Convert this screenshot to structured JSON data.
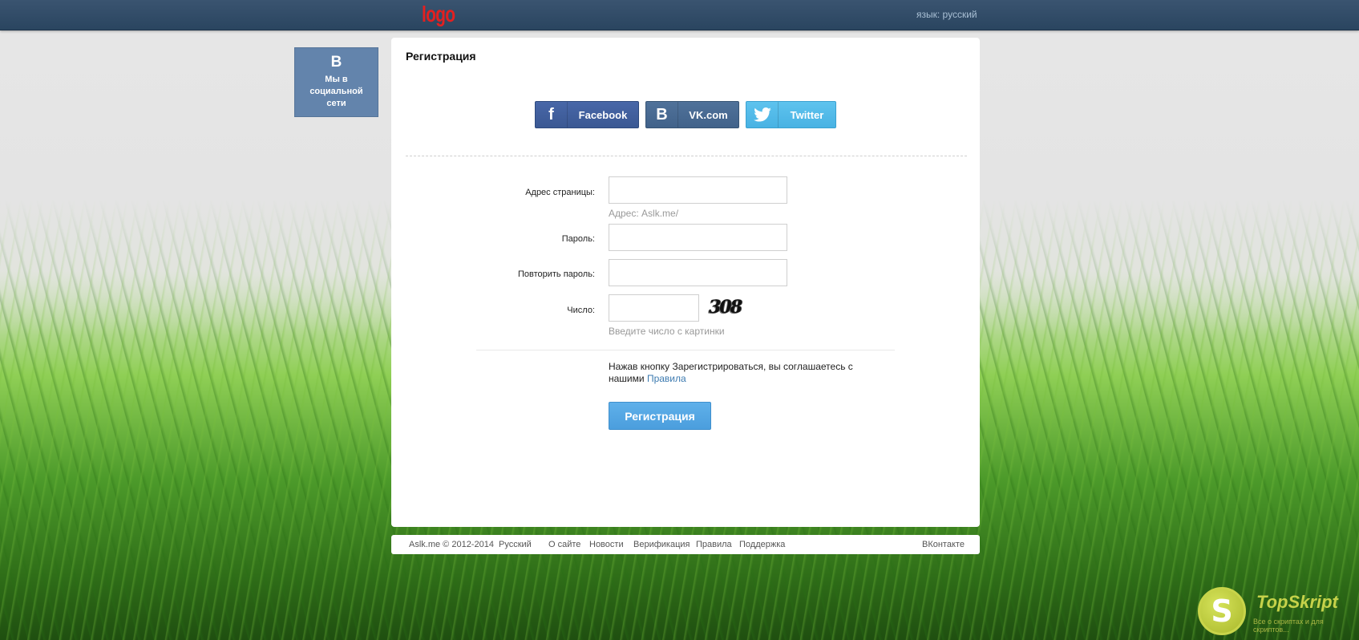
{
  "header": {
    "logo": "logo",
    "language_link": "язык: русский"
  },
  "social_sidebar": {
    "icon_letter": "B",
    "label": "Мы в социальной сети"
  },
  "registration": {
    "title": "Регистрация",
    "social_buttons": [
      {
        "icon": "f",
        "label": "Facebook"
      },
      {
        "icon": "B",
        "label": "VK.com"
      },
      {
        "icon": "twitter-bird-icon",
        "label": "Twitter"
      }
    ],
    "fields": {
      "page_address": {
        "label": "Адрес страницы:",
        "value": "",
        "hint": "Адрес: Aslk.me/"
      },
      "password": {
        "label": "Пароль:",
        "value": ""
      },
      "repeat_password": {
        "label": "Повторить пароль:",
        "value": ""
      },
      "number": {
        "label": "Число:",
        "value": "",
        "captcha": "308",
        "hint": "Введите число с картинки"
      }
    },
    "agreement_text": "Нажав кнопку Зарегистрироваться, вы соглашаетесь с нашими",
    "agreement_link": "Правила",
    "submit_label": "Регистрация"
  },
  "footer": {
    "copyright": "Aslk.me © 2012-2014",
    "language": "Русский",
    "links": [
      "О сайте",
      "Новости",
      "Верификация",
      "Правила",
      "Поддержка"
    ],
    "vk_link": "ВКонтакте"
  },
  "watermark": {
    "letter": "S",
    "title": "TopSkript",
    "subtitle": "Все о скриптах и для скриптов..."
  },
  "colors": {
    "topbar": "#2f4a66",
    "logo": "#e32020",
    "facebook": "#3b5998",
    "vk": "#45668e",
    "twitter": "#55acee",
    "submit": "#4fa3e0",
    "link": "#3c7ab0"
  }
}
